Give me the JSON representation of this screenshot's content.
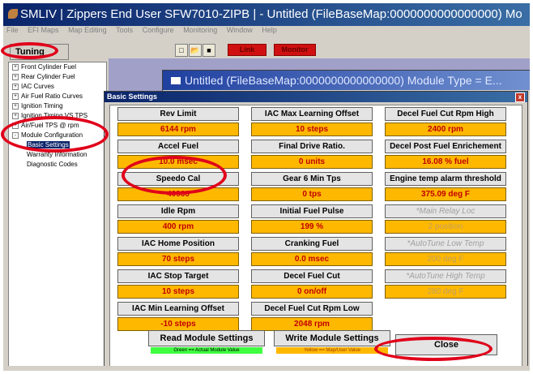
{
  "window": {
    "title": "SMLIV  |  Zippers End User SFW7010-ZIPB  |  - Untitled      (FileBaseMap:0000000000000000) Mo"
  },
  "menu": [
    "File",
    "EFI Maps",
    "Map Editing",
    "Tools",
    "Configure",
    "Monitoring",
    "Window",
    "Help"
  ],
  "toolbar": {
    "icons": [
      "new-icon",
      "open-icon",
      "save-icon"
    ],
    "link_label": "Link",
    "monitor_label": "Monitor"
  },
  "tuning_maps": {
    "header": "Tuning Maps",
    "items": [
      {
        "label": "Front Cylinder Fuel",
        "toggle": "+"
      },
      {
        "label": "Rear Cylinder Fuel",
        "toggle": "+"
      },
      {
        "label": "IAC Curves",
        "toggle": "+"
      },
      {
        "label": "Air Fuel Ratio Curves",
        "toggle": "+"
      },
      {
        "label": "Ignition Timing",
        "toggle": "+"
      },
      {
        "label": "Ignition Timing VS TPS",
        "toggle": "+"
      },
      {
        "label": "Air/Fuel TPS @ rpm",
        "toggle": "+"
      },
      {
        "label": "Module Configuration",
        "toggle": "-"
      }
    ],
    "children": [
      "Basic Settings",
      "Warranty Information",
      "Diagnostic Codes"
    ]
  },
  "child_window": {
    "title": "Untitled      (FileBaseMap:0000000000000000) Module Type = E..."
  },
  "dialog": {
    "title": "Basic Settings",
    "close_glyph": "x",
    "settings": [
      {
        "label": "Rev Limit",
        "value": "6144 rpm"
      },
      {
        "label": "IAC Max Learning Offset",
        "value": "10 steps"
      },
      {
        "label": "Decel Fuel Cut Rpm High",
        "value": "2400 rpm"
      },
      {
        "label": "Accel Fuel",
        "value": "10.0 msec"
      },
      {
        "label": "Final Drive Ratio.",
        "value": "0 units"
      },
      {
        "label": "Decel Post Fuel Enrichement",
        "value": "16.08 % fuel"
      },
      {
        "label": "Speedo Cal",
        "value": "40960"
      },
      {
        "label": "Gear 6 Min Tps",
        "value": "0 tps"
      },
      {
        "label": "Engine temp alarm threshold",
        "value": "375.09 deg F"
      },
      {
        "label": "Idle Rpm",
        "value": "400 rpm"
      },
      {
        "label": "Initial Fuel Pulse",
        "value": "199 %"
      },
      {
        "label": "*Main Relay Loc",
        "value": "2 position",
        "disabled": true
      },
      {
        "label": "IAC Home Position",
        "value": "70 steps"
      },
      {
        "label": "Cranking Fuel",
        "value": "0.0 msec"
      },
      {
        "label": "*AutoTune Low Temp",
        "value": "200 deg F",
        "disabled": true
      },
      {
        "label": "IAC Stop Target",
        "value": "10 steps"
      },
      {
        "label": "Decel Fuel Cut",
        "value": "0 on/off"
      },
      {
        "label": "*AutoTune High Temp",
        "value": "280 deg F",
        "disabled": true
      },
      {
        "label": "IAC Min Learning Offset",
        "value": "-10 steps"
      },
      {
        "label": "Decel Fuel Cut Rpm Low",
        "value": "2048 rpm"
      }
    ],
    "read_button": "Read Module Settings",
    "write_button": "Write Module Settings",
    "close_button": "Close",
    "legend_actual": "Green == Actual Module Value",
    "legend_map": "Yellow == Map/User Value",
    "colors": {
      "legend_green": "#40ff40",
      "legend_yellow": "#ffb800",
      "value_text": "#c00000",
      "annotation": "#e0001a"
    }
  }
}
